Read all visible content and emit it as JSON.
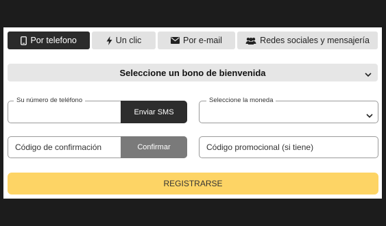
{
  "tabs": [
    {
      "label": "Por telefono",
      "icon": "phone-icon",
      "active": true
    },
    {
      "label": "Un clic",
      "icon": "lightning-icon",
      "active": false
    },
    {
      "label": "Por e-mail",
      "icon": "envelope-icon",
      "active": false
    },
    {
      "label": "Redes sociales y mensajería",
      "icon": "users-icon",
      "active": false
    }
  ],
  "bonus": {
    "label": "Seleccione un bono de bienvenida"
  },
  "phone": {
    "legend": "Su número de teléfono",
    "value": "",
    "button": "Enviar SMS"
  },
  "currency": {
    "legend": "Seleccione la moneda",
    "value": ""
  },
  "code": {
    "placeholder": "Código de confirmación",
    "button": "Confirmar"
  },
  "promo": {
    "placeholder": "Código promocional (si tiene)"
  },
  "register": {
    "label": "REGISTRARSE"
  },
  "colors": {
    "accent": "#fdd465",
    "dark": "#2b2b2b",
    "tab_bg": "#e2e2e2",
    "confirm_bg": "#7a7a7a"
  }
}
